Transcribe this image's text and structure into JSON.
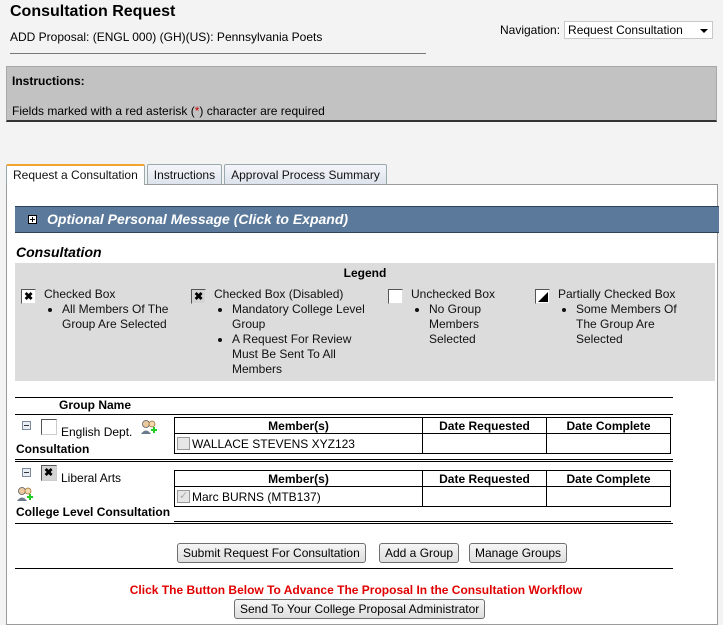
{
  "header": {
    "title": "Consultation Request",
    "subtitle": "ADD Proposal: (ENGL 000) (GH)(US): Pennsylvania Poets"
  },
  "navigation": {
    "label": "Navigation:",
    "selected": "Request Consultation"
  },
  "instructions": {
    "title": "Instructions:",
    "text_before": "Fields marked with a red asterisk (",
    "asterisk": "*",
    "text_after": ") character are required"
  },
  "tabs": [
    {
      "label": "Request a Consultation",
      "active": true
    },
    {
      "label": "Instructions",
      "active": false
    },
    {
      "label": "Approval Process Summary",
      "active": false
    }
  ],
  "optional_message": {
    "label": "Optional Personal Message (Click to Expand)",
    "icon": "expand-plus-icon"
  },
  "consultation": {
    "label": "Consultation",
    "legend": {
      "title": "Legend",
      "items": [
        {
          "label": "Checked Box",
          "state": "checked",
          "bullets": [
            "All Members Of The Group Are Selected"
          ]
        },
        {
          "label": "Checked Box (Disabled)",
          "state": "checked-disabled",
          "bullets": [
            "Mandatory College Level Group",
            "A Request For Review Must Be Sent To All Members"
          ]
        },
        {
          "label": "Unchecked Box",
          "state": "unchecked",
          "bullets": [
            "No Group Members Selected"
          ]
        },
        {
          "label": "Partially Checked Box",
          "state": "partial",
          "bullets": [
            "Some Members Of The Group Are Selected"
          ]
        }
      ]
    },
    "group_name_header": "Group Name",
    "table_headers": [
      "Member(s)",
      "Date Requested",
      "Date Complete"
    ],
    "groups": [
      {
        "name": "English Dept.",
        "type": "Consultation",
        "checkbox": "unchecked",
        "members": [
          {
            "name": "WALLACE STEVENS",
            "id": "XYZ123",
            "checked": false,
            "date_requested": "",
            "date_complete": ""
          }
        ]
      },
      {
        "name": "Liberal Arts",
        "type": "College Level Consultation",
        "checkbox": "checked-disabled",
        "members": [
          {
            "name": "Marc BURNS (MTB137)",
            "id": "",
            "checked": true,
            "date_requested": "",
            "date_complete": ""
          }
        ]
      }
    ]
  },
  "buttons": {
    "submit": "Submit Request For Consultation",
    "add_group": "Add a Group",
    "manage_groups": "Manage Groups",
    "send": "Send To Your College Proposal Administrator"
  },
  "workflow_message": "Click The Button Below To Advance The Proposal In the Consultation Workflow"
}
